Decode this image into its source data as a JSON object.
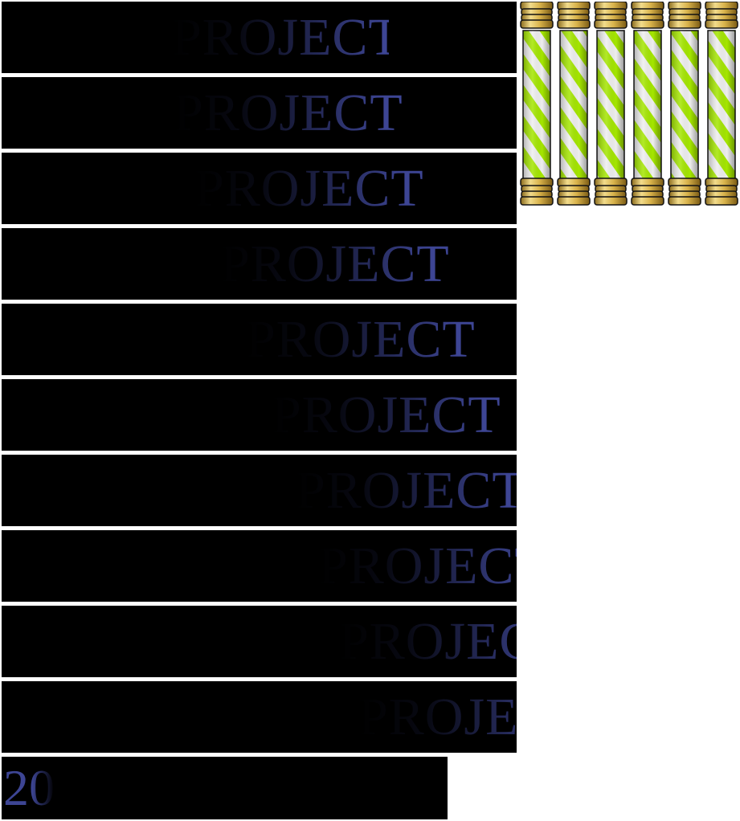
{
  "sprite_sheet": {
    "title_frames": [
      {
        "text": "PROJECT"
      },
      {
        "text": "PROJECT"
      },
      {
        "text": "PROJECT"
      },
      {
        "text": "PROJECT"
      },
      {
        "text": "PROJECT"
      },
      {
        "text": "PROJECT"
      },
      {
        "text": "PROJECT"
      },
      {
        "text": "PROJECT"
      },
      {
        "text": "PROJECT"
      },
      {
        "text": "PROJECT"
      }
    ],
    "small_frame": {
      "text": "20"
    },
    "pillar_count": 6,
    "colors": {
      "frame_background": "#000000",
      "title_text": "#3d4594",
      "pillar_stripe_green": "#a4e600",
      "pillar_stripe_white": "#eeeeee",
      "pillar_cap_gold": "#d8b24a",
      "outline": "#111111",
      "sheet_background": "#ffffff"
    }
  }
}
